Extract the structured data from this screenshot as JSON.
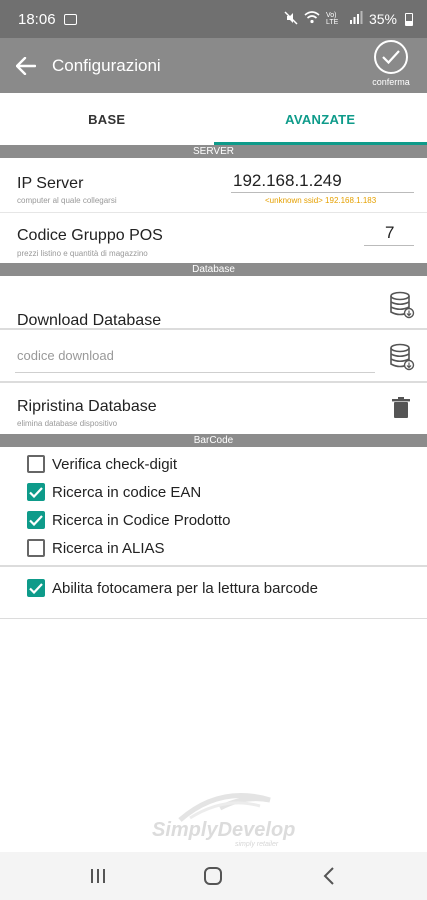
{
  "status_bar": {
    "time": "18:06",
    "network": "Vo) LTE",
    "battery": "35%"
  },
  "toolbar": {
    "title": "Configurazioni",
    "confirm_label": "conferma"
  },
  "tabs": [
    {
      "label": "BASE"
    },
    {
      "label": "AVANZATE"
    }
  ],
  "sections": {
    "server": "SERVER",
    "database": "Database",
    "barcode": "BarCode"
  },
  "server": {
    "ip_label": "IP Server",
    "ip_sub": "computer al quale collegarsi",
    "ip_value": "192.168.1.249",
    "ssid_hint": "<unknown ssid>  192.168.1.183",
    "pos_label": "Codice Gruppo POS",
    "pos_sub": "prezzi listino e quantità di magazzino",
    "pos_value": "7"
  },
  "database": {
    "download_label": "Download Database",
    "code_placeholder": "codice download",
    "restore_label": "Ripristina Database",
    "restore_sub": "elimina database dispositivo"
  },
  "barcode": {
    "options": [
      {
        "label": "Verifica check-digit",
        "checked": false
      },
      {
        "label": "Ricerca in codice EAN",
        "checked": true
      },
      {
        "label": "Ricerca in Codice Prodotto",
        "checked": true
      },
      {
        "label": "Ricerca in ALIAS",
        "checked": false
      }
    ],
    "camera_label": "Abilita fotocamera per la lettura barcode",
    "camera_checked": true
  },
  "watermark": {
    "brand": "SimplyDevelop",
    "tagline": "simply retailer"
  },
  "colors": {
    "accent": "#0e9b8a",
    "toolbar": "#8a8a8a",
    "statusbar": "#707070",
    "section": "#8c8c8c",
    "ssid": "#e5a000"
  }
}
